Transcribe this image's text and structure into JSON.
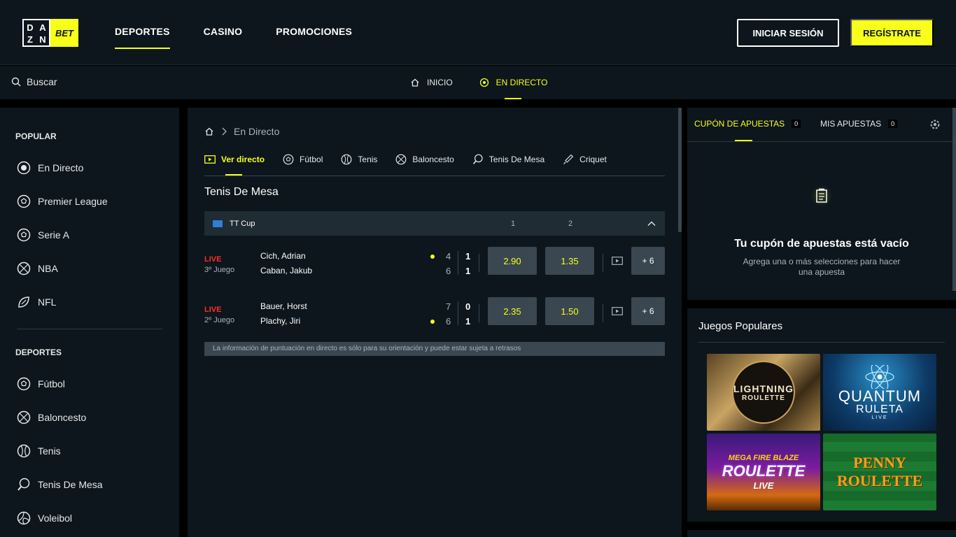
{
  "header": {
    "logo_left": [
      "D",
      "A",
      "Z",
      "N"
    ],
    "logo_right": "BET",
    "nav": [
      "DEPORTES",
      "CASINO",
      "PROMOCIONES"
    ],
    "login": "INICIAR SESIÓN",
    "register": "REGÍSTRATE"
  },
  "subbar": {
    "search_label": "Buscar",
    "nav": [
      "INICIO",
      "EN DIRECTO"
    ]
  },
  "sidebar": {
    "popular_heading": "POPULAR",
    "popular": [
      "En Directo",
      "Premier League",
      "Serie A",
      "NBA",
      "NFL"
    ],
    "sports_heading": "DEPORTES",
    "sports": [
      "Fútbol",
      "Baloncesto",
      "Tenis",
      "Tenis De Mesa",
      "Voleibol"
    ]
  },
  "main": {
    "breadcrumb": "En Directo",
    "tabs": [
      "Ver directo",
      "Fútbol",
      "Tenis",
      "Baloncesto",
      "Tenis De Mesa",
      "Criquet"
    ],
    "section_title": "Tenis De Mesa",
    "league": {
      "name": "TT Cup",
      "col1": "1",
      "col2": "2"
    },
    "matches": [
      {
        "status": "LIVE",
        "period": "3º Juego",
        "p1": "Cich, Adrian",
        "p2": "Caban, Jakub",
        "g1": "4",
        "g2": "6",
        "s1": "1",
        "s2": "1",
        "odd1": "2.90",
        "odd2": "1.35",
        "more": "+ 6",
        "serve": 1
      },
      {
        "status": "LIVE",
        "period": "2º Juego",
        "p1": "Bauer, Horst",
        "p2": "Plachy, Jiri",
        "g1": "7",
        "g2": "6",
        "s1": "0",
        "s2": "1",
        "odd1": "2.35",
        "odd2": "1.50",
        "more": "+ 6",
        "serve": 2
      }
    ],
    "notice": "La información de puntuación en directo es sólo para su orientación y puede estar sujeta a retrasos"
  },
  "betslip": {
    "tab1": "CUPÓN DE APUESTAS",
    "tab1_count": "0",
    "tab2": "MIS APUESTAS",
    "tab2_count": "0",
    "empty_title": "Tu cupón de apuestas está vacío",
    "empty_sub": "Agrega una o más selecciones para hacer una apuesta"
  },
  "games": {
    "title": "Juegos Populares",
    "tiles": [
      {
        "line1": "LIGHTNING",
        "line2": "ROULETTE"
      },
      {
        "line1": "QUANTUM",
        "line2": "RULETA",
        "line3": "LIVE"
      },
      {
        "line1": "MEGA FIRE BLAZE",
        "line2": "ROULETTE",
        "line3": "LIVE"
      },
      {
        "line1": "PENNY",
        "line2": "ROULETTE"
      }
    ]
  },
  "colors": {
    "accent": "#f7ff1a",
    "panel": "#0c161c",
    "live": "#ff2d2d",
    "odd_bg": "#3a4750"
  }
}
